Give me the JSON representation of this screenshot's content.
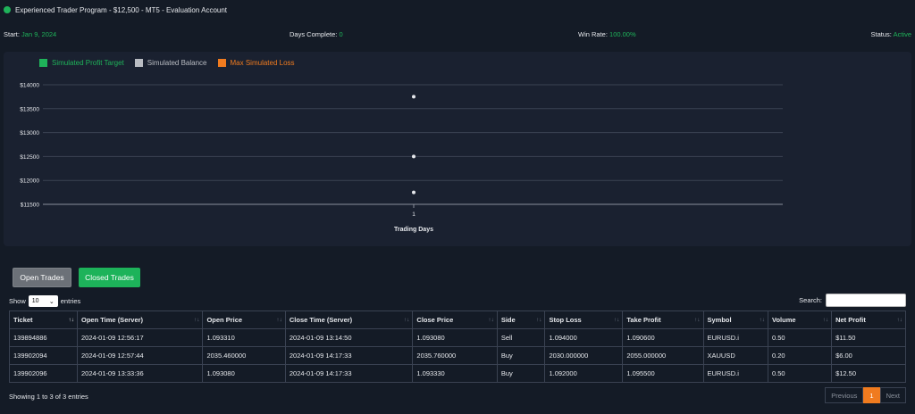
{
  "header": {
    "title": "Experienced Trader Program - $12,500 - MT5 - Evaluation Account",
    "status_color": "#1fb35a"
  },
  "stats": {
    "start_label": "Start:",
    "start_value": "Jan 9, 2024",
    "days_label": "Days Complete:",
    "days_value": "0",
    "winrate_label": "Win Rate:",
    "winrate_value": "100.00%",
    "status_label": "Status:",
    "status_value": "Active"
  },
  "legend": [
    {
      "label": "Simulated Profit Target",
      "color": "#1fb35a"
    },
    {
      "label": "Simulated Balance",
      "color": "#b9bcc2"
    },
    {
      "label": "Max Simulated Loss",
      "color": "#f07b1f"
    }
  ],
  "chart_data": {
    "type": "scatter",
    "xlabel": "Trading Days",
    "ylabel": "",
    "x_ticks": [
      "1"
    ],
    "y_ticks": [
      "$14000",
      "$13500",
      "$13000",
      "$12500",
      "$12000",
      "$11500"
    ],
    "ylim": [
      11500,
      14000
    ],
    "grid": true,
    "legend_position": "top-left",
    "points": [
      {
        "x": 1,
        "y": 13750
      },
      {
        "x": 1,
        "y": 12500
      },
      {
        "x": 1,
        "y": 11750
      }
    ]
  },
  "buttons": {
    "open_trades": "Open Trades",
    "closed_trades": "Closed Trades"
  },
  "controls": {
    "show": "Show",
    "entries_value": "10",
    "entries": "entries",
    "search": "Search:"
  },
  "table": {
    "columns": [
      "Ticket",
      "Open Time (Server)",
      "Open Price",
      "Close Time (Server)",
      "Close Price",
      "Side",
      "Stop Loss",
      "Take Profit",
      "Symbol",
      "Volume",
      "Net Profit"
    ],
    "rows": [
      [
        "139894886",
        "2024-01-09 12:56:17",
        "1.093310",
        "2024-01-09 13:14:50",
        "1.093080",
        "Sell",
        "1.094000",
        "1.090600",
        "EURUSD.i",
        "0.50",
        "$11.50"
      ],
      [
        "139902094",
        "2024-01-09 12:57:44",
        "2035.460000",
        "2024-01-09 14:17:33",
        "2035.760000",
        "Buy",
        "2030.000000",
        "2055.000000",
        "XAUUSD",
        "0.20",
        "$6.00"
      ],
      [
        "139902096",
        "2024-01-09 13:33:36",
        "1.093080",
        "2024-01-09 14:17:33",
        "1.093330",
        "Buy",
        "1.092000",
        "1.095500",
        "EURUSD.i",
        "0.50",
        "$12.50"
      ]
    ]
  },
  "footer": {
    "info": "Showing 1 to 3 of 3 entries",
    "previous": "Previous",
    "page": "1",
    "next": "Next"
  }
}
